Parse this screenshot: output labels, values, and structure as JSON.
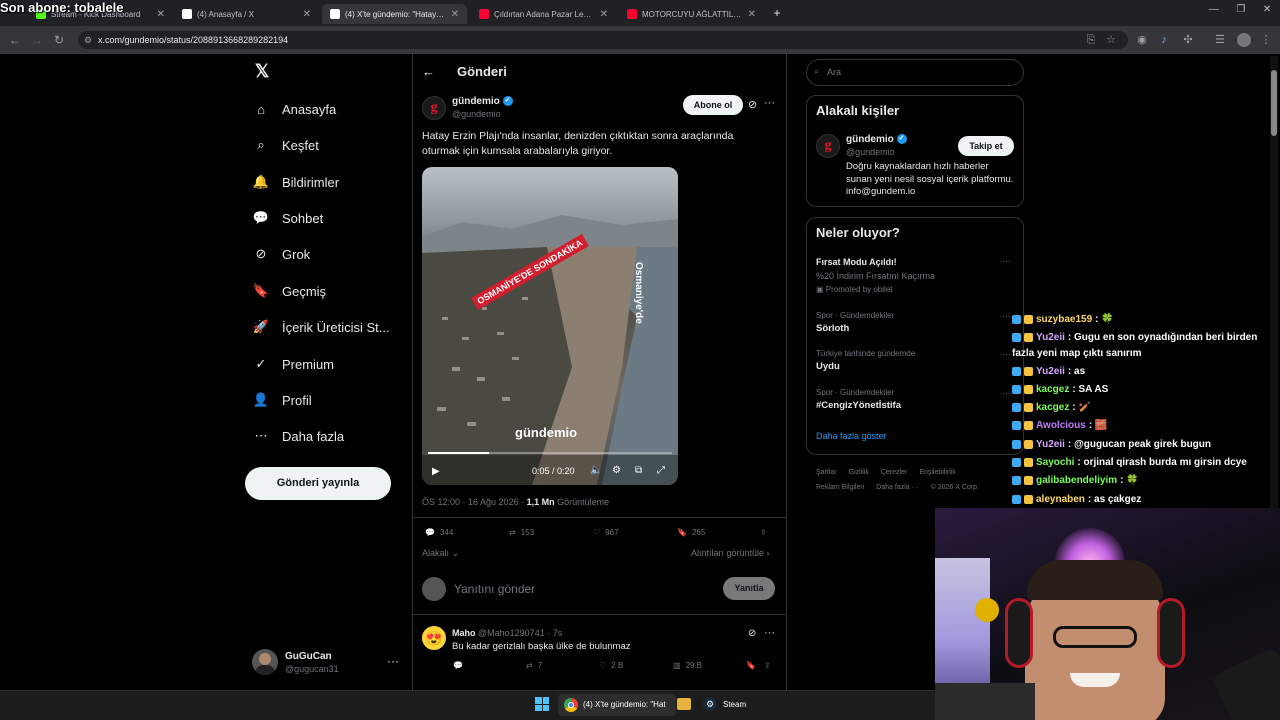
{
  "overlay": {
    "sub_goal": "Son abone: tobalele"
  },
  "browser": {
    "tabs": [
      {
        "label": "Stream - Kick Dashboard",
        "color": "#53fc18"
      },
      {
        "label": "(4) Anasayfa / X",
        "color": "#ffffff"
      },
      {
        "label": "(4) X'te gündemio: \"Hatay Erzin",
        "color": "#ffffff"
      },
      {
        "label": "Çıldırtan Adana Pazar Lezzetleri",
        "color": "#ff0033"
      },
      {
        "label": "MOTORCUYU AĞLATTILAR: Tür",
        "color": "#ff0033"
      }
    ],
    "url": "x.com/gundemio/status/2088913668289282194"
  },
  "nav": {
    "items": [
      "Anasayfa",
      "Keşfet",
      "Bildirimler",
      "Sohbet",
      "Grok",
      "Geçmiş",
      "İçerik Üreticisi St...",
      "Premium",
      "Profil",
      "Daha fazla"
    ],
    "post_button": "Gönderi yayınla",
    "user": {
      "name": "GuGuCan",
      "handle": "@gugucan31"
    }
  },
  "post": {
    "header": "Gönderi",
    "author": {
      "name": "gündemio",
      "handle": "@gundemio"
    },
    "subscribe": "Abone ol",
    "text": "Hatay Erzin Plajı'nda insanlar, denizden çıktıktan sonra araçlarında oturmak için kumsala arabalarıyla giriyor.",
    "video": {
      "time": "0:05 / 0:20",
      "progress": 0.25,
      "overlay_left": "OSMANİYE'DE SONDAKİKA",
      "overlay_right": "Osmaniye'de",
      "watermark": "gündemio"
    },
    "time": "ÖS 12:00 · 16 Ağu 2026 · ",
    "views": "1,1 Mn",
    "views_label": " Görüntüleme",
    "stats": {
      "replies": "344",
      "reposts": "153",
      "likes": "967",
      "bookmarks": "265"
    },
    "sort": "Alakalı",
    "quotes_link": "Alıntıları görüntüle",
    "reply_placeholder": "Yanıtını gönder",
    "reply_button": "Yanıtla"
  },
  "reply": {
    "name": "Maho",
    "handle": "@Maho1290741",
    "time": "· 7s",
    "text": "Bu kadar gerizlalı başka ülke de bulunmaz",
    "stats": {
      "reposts": "7",
      "likes": "2 B",
      "views": "29 B"
    }
  },
  "sidebar": {
    "search_placeholder": "Ara",
    "related": {
      "title": "Alakalı kişiler",
      "name": "gündemio",
      "handle": "@gundemio",
      "follow": "Takip et",
      "bio": "Doğru kaynaklardan hızlı haberler sunan yeni nesil sosyal içerik platformu. info@gundem.io"
    },
    "trends": {
      "title": "Neler oluyor?",
      "ad": {
        "title": "Fırsat Modu Açıldı!",
        "subtitle": "%20 İndirim Fırsatını Kaçırma",
        "promoted": "Promoted by obilet"
      },
      "items": [
        {
          "context": "Spor · Gündemdekiler",
          "name": "Sörloth"
        },
        {
          "context": "Türkiye tarihinde gündemde",
          "name": "Uydu"
        },
        {
          "context": "Spor · Gündemdekiler",
          "name": "#CengizYönetİstifa"
        }
      ],
      "more": "Daha fazla göster"
    },
    "footer": [
      "Şartlar",
      "Gizlilik",
      "Çerezler",
      "Erişilebilirlik",
      "Reklam Bilgileri",
      "Daha fazla ···",
      "© 2026 X Corp."
    ]
  },
  "chat": [
    {
      "user": "suzybae159",
      "color": "#ffd966",
      "msg": " : 🍀"
    },
    {
      "user": "Yu2eii",
      "color": "#d6a8ff",
      "msg": " : Gugu en son oynadığından beri birden"
    },
    {
      "user": "",
      "color": "#ffffff",
      "msg": "fazla yeni map çıktı sanırım"
    },
    {
      "user": "Yu2eii",
      "color": "#d6a8ff",
      "msg": " : as"
    },
    {
      "user": "kacgez",
      "color": "#7cfc5a",
      "msg": " : SA AS"
    },
    {
      "user": "kacgez",
      "color": "#7cfc5a",
      "msg": " : 🏏"
    },
    {
      "user": "Awolcious",
      "color": "#c07bff",
      "msg": " : 🧱"
    },
    {
      "user": "Yu2eii",
      "color": "#d6a8ff",
      "msg": " : @gugucan peak girek bugun"
    },
    {
      "user": "Sayochi",
      "color": "#7cfc5a",
      "msg": " : orjinal qirash burda mı girsin dcye"
    },
    {
      "user": "galibabendeliyim",
      "color": "#7cfc5a",
      "msg": " : 🍀"
    },
    {
      "user": "aleynaben",
      "color": "#ffd966",
      "msg": " : as çakgez"
    }
  ],
  "taskbar": {
    "items": [
      "(4) X'te gündemio: \"Hat",
      "Steam"
    ]
  }
}
